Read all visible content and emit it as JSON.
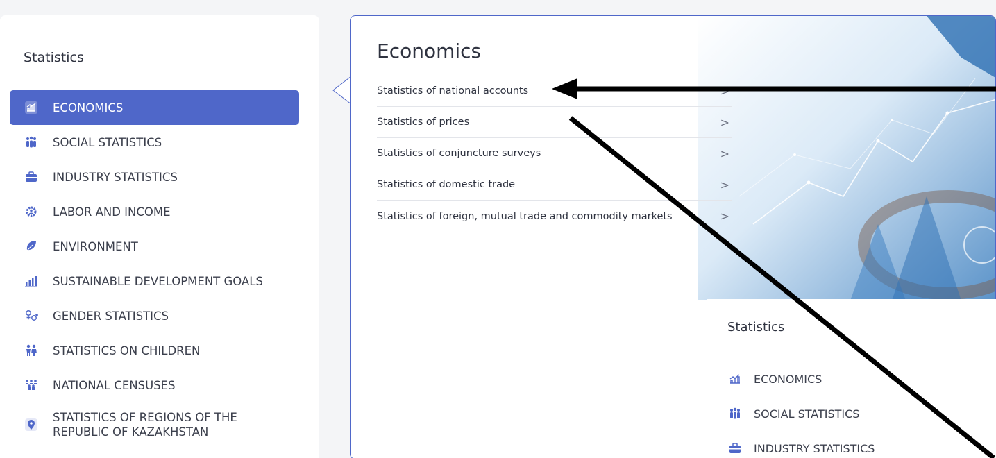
{
  "sidebar": {
    "title": "Statistics",
    "items": [
      {
        "label": "ECONOMICS",
        "icon": "chart-building-icon"
      },
      {
        "label": "SOCIAL STATISTICS",
        "icon": "people-group-icon"
      },
      {
        "label": "INDUSTRY STATISTICS",
        "icon": "briefcase-icon"
      },
      {
        "label": "LABOR AND INCOME",
        "icon": "gear-person-icon"
      },
      {
        "label": "ENVIRONMENT",
        "icon": "leaf-icon"
      },
      {
        "label": "SUSTAINABLE DEVELOPMENT GOALS",
        "icon": "bar-chart-icon"
      },
      {
        "label": "GENDER STATISTICS",
        "icon": "gender-icon"
      },
      {
        "label": "STATISTICS ON CHILDREN",
        "icon": "children-icon"
      },
      {
        "label": "NATIONAL CENSUSES",
        "icon": "census-people-icon"
      },
      {
        "label": "STATISTICS OF REGIONS OF THE REPUBLIC OF KAZAKHSTAN",
        "icon": "map-pin-icon"
      }
    ]
  },
  "panel": {
    "title": "Economics",
    "items": [
      {
        "label": "Statistics of national accounts"
      },
      {
        "label": "Statistics of prices"
      },
      {
        "label": "Statistics of conjuncture surveys"
      },
      {
        "label": "Statistics of domestic trade"
      },
      {
        "label": "Statistics of foreign, mutual trade and commodity markets"
      }
    ],
    "chevron": ">"
  },
  "inset": {
    "title": "Statistics",
    "items": [
      {
        "label": "ECONOMICS"
      },
      {
        "label": "SOCIAL STATISTICS"
      },
      {
        "label": "INDUSTRY STATISTICS"
      }
    ]
  },
  "colors": {
    "accent": "#4f67c9",
    "background": "#f4f5f7"
  }
}
